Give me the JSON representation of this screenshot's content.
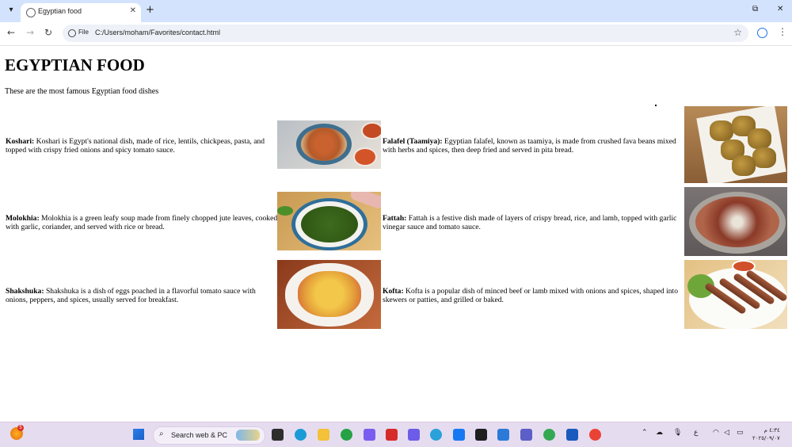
{
  "browser": {
    "tab_title": "Egyptian food",
    "file_chip": "File",
    "url": "C:/Users/moham/Favorites/contact.html"
  },
  "page": {
    "title": "EGYPTIAN FOOD",
    "intro": "These are the most famous Egyptian food dishes",
    "dishes": [
      {
        "name": "Koshari:",
        "text": " Koshari is Egypt's national dish, made of rice, lentils, chickpeas, pasta, and topped with crispy fried onions and spicy tomato sauce."
      },
      {
        "name": "Falafel (Taamiya):",
        "text": " Egyptian falafel, known as taamiya, is made from crushed fava beans mixed with herbs and spices, then deep fried and served in pita bread."
      },
      {
        "name": "Molokhia:",
        "text": " Molokhia is a green leafy soup made from finely chopped jute leaves, cooked with garlic, coriander, and served with rice or bread."
      },
      {
        "name": "Fattah:",
        "text": " Fattah is a festive dish made of layers of crispy bread, rice, and lamb, topped with garlic vinegar sauce and tomato sauce."
      },
      {
        "name": "Shakshuka:",
        "text": " Shakshuka is a dish of eggs poached in a flavorful tomato sauce with onions, peppers, and spices, usually served for breakfast."
      },
      {
        "name": "Kofta:",
        "text": " Kofta is a popular dish of minced beef or lamb mixed with onions and spices, shaped into skewers or patties, and grilled or baked."
      }
    ]
  },
  "taskbar": {
    "search_text": "Search web & PC",
    "weather_badge": "5",
    "clock_time": "٤:٣٤ م",
    "clock_date": "٢٠٢٥/٠٩/٠٧"
  }
}
